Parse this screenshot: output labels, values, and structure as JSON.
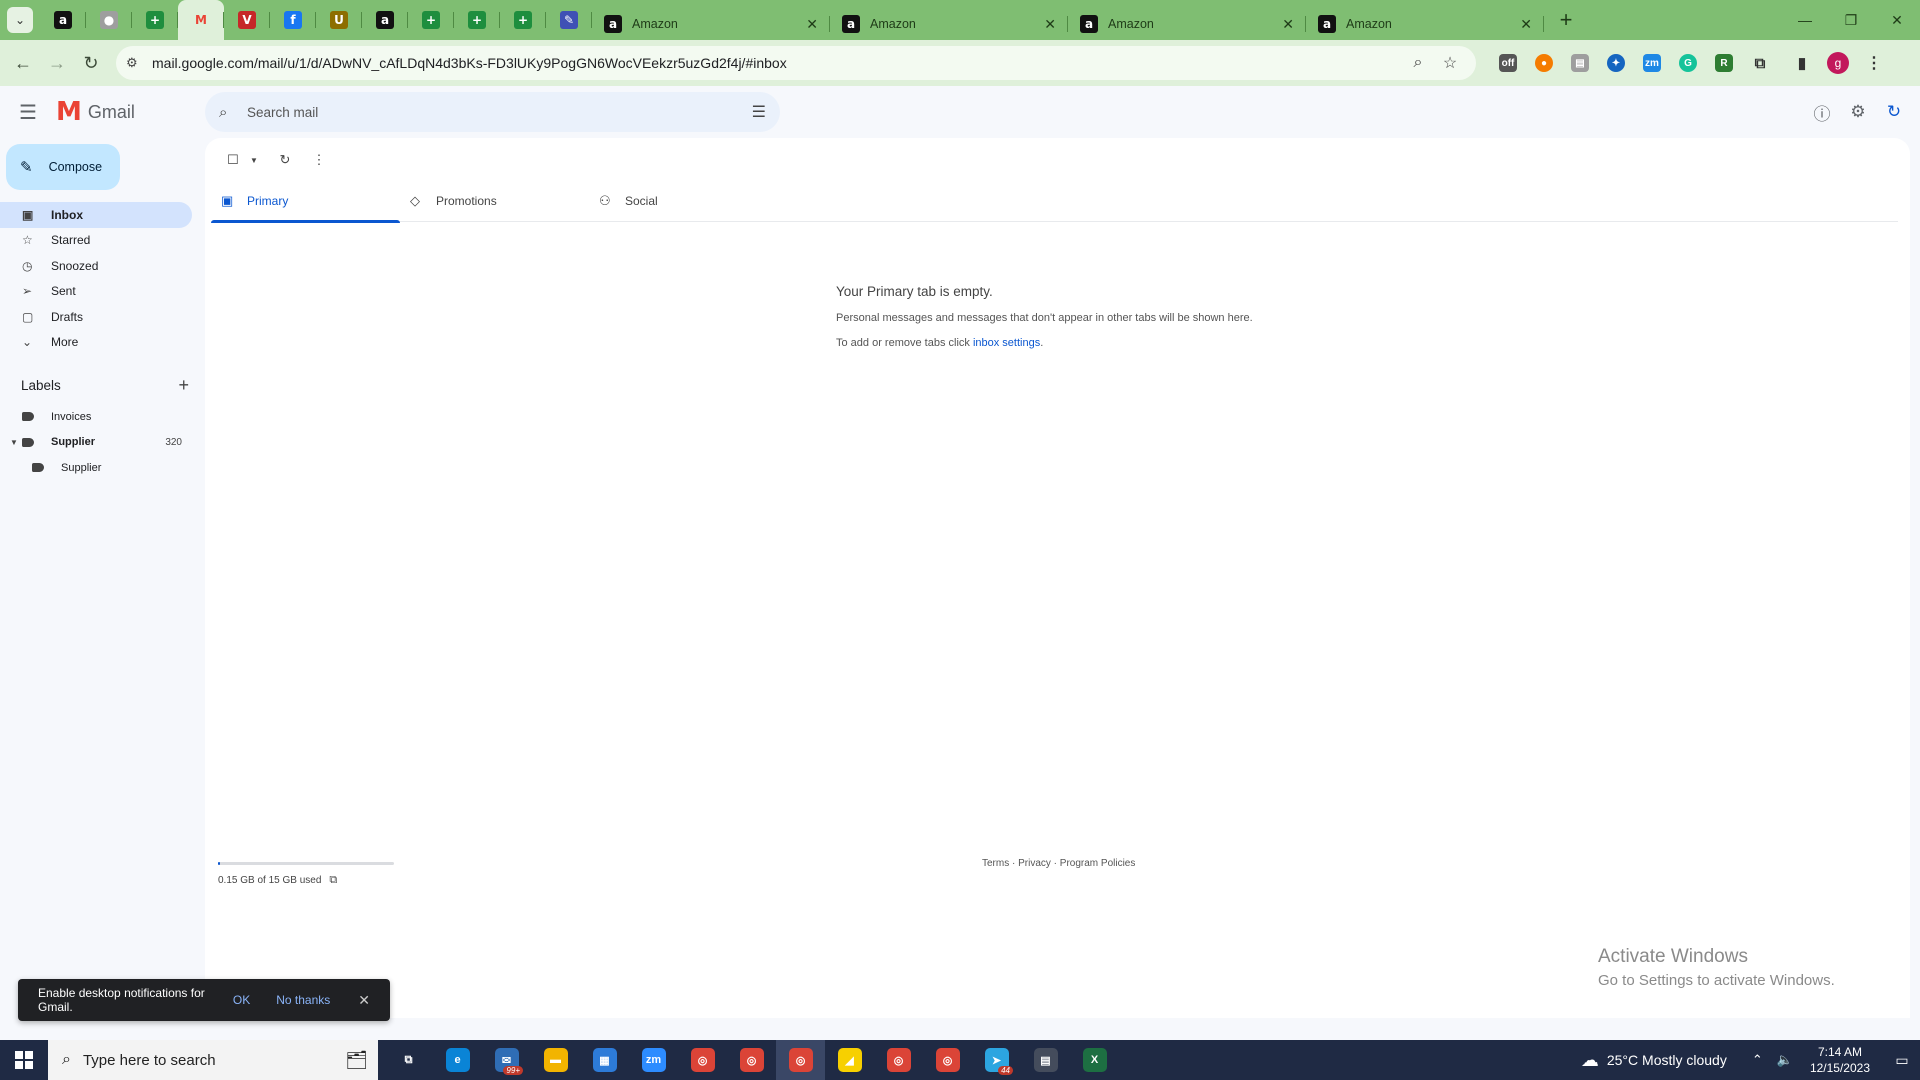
{
  "browser": {
    "tab_menu_icon": "chevron-down-icon",
    "pinned_tabs": [
      {
        "icon": "amazon-icon",
        "glyph": "a",
        "color": "#111111"
      },
      {
        "icon": "gray-circle-icon",
        "glyph": "●",
        "color": "#9e9e9e"
      },
      {
        "icon": "green-sheets-icon",
        "glyph": "+",
        "color": "#1e8e3e"
      },
      {
        "icon": "gmail-icon",
        "glyph": "M",
        "color": "#ea4335"
      },
      {
        "icon": "red-v-icon",
        "glyph": "V",
        "color": "#c62828"
      },
      {
        "icon": "facebook-icon",
        "glyph": "f",
        "color": "#1877f2"
      },
      {
        "icon": "us-flag-icon",
        "glyph": "U",
        "color": "#8d6e00"
      },
      {
        "icon": "amazon-icon",
        "glyph": "a",
        "color": "#111111"
      },
      {
        "icon": "green-sheets-icon",
        "glyph": "+",
        "color": "#1e8e3e"
      },
      {
        "icon": "green-sheets-icon",
        "glyph": "+",
        "color": "#1e8e3e"
      },
      {
        "icon": "green-sheets-icon",
        "glyph": "+",
        "color": "#1e8e3e"
      },
      {
        "icon": "feather-icon",
        "glyph": "✎",
        "color": "#3f51b5"
      }
    ],
    "tabs": [
      {
        "label": "Amazon"
      },
      {
        "label": "Amazon"
      },
      {
        "label": "Amazon"
      },
      {
        "label": "Amazon"
      }
    ],
    "url": "mail.google.com/mail/u/1/d/ADwNV_cAfLDqN4d3bKs-FD3lUKy9PogGN6WocVEekzr5uzGd2f4j/#inbox",
    "profile_initial": "g"
  },
  "gmail": {
    "app_name": "Gmail",
    "search_placeholder": "Search mail",
    "compose_label": "Compose",
    "nav": [
      {
        "label": "Inbox",
        "icon": "inbox-icon",
        "glyph": "▣",
        "active": true
      },
      {
        "label": "Starred",
        "icon": "star-icon",
        "glyph": "☆",
        "active": false
      },
      {
        "label": "Snoozed",
        "icon": "clock-icon",
        "glyph": "◷",
        "active": false
      },
      {
        "label": "Sent",
        "icon": "send-icon",
        "glyph": "➢",
        "active": false
      },
      {
        "label": "Drafts",
        "icon": "draft-icon",
        "glyph": "▢",
        "active": false
      },
      {
        "label": "More",
        "icon": "chevron-down-icon",
        "glyph": "⌄",
        "active": false
      }
    ],
    "labels_title": "Labels",
    "labels": [
      {
        "name": "Invoices",
        "count": "",
        "expanded": false,
        "bold": false
      },
      {
        "name": "Supplier",
        "count": "320",
        "expanded": true,
        "bold": true
      },
      {
        "name": "Supplier",
        "count": "",
        "expanded": false,
        "bold": false,
        "child": true
      }
    ],
    "category_tabs": [
      {
        "label": "Primary",
        "icon": "inbox-icon",
        "glyph": "▣",
        "active": true
      },
      {
        "label": "Promotions",
        "icon": "tag-icon",
        "glyph": "◇",
        "active": false
      },
      {
        "label": "Social",
        "icon": "people-icon",
        "glyph": "⚇",
        "active": false
      }
    ],
    "empty_state": {
      "title": "Your Primary tab is empty.",
      "line1": "Personal messages and messages that don't appear in other tabs will be shown here.",
      "line2_prefix": "To add or remove tabs click ",
      "line2_link": "inbox settings",
      "line2_suffix": "."
    },
    "storage": {
      "text": "0.15 GB of 15 GB used",
      "fraction_used": 0.01
    },
    "footer": "Terms · Privacy · Program Policies",
    "snackbar": {
      "text": "Enable desktop notifications for Gmail.",
      "ok": "OK",
      "no": "No thanks"
    }
  },
  "windows": {
    "watermark_line1": "Activate Windows",
    "watermark_line2": "Go to Settings to activate Windows.",
    "search_placeholder": "Type here to search",
    "weather": "25°C  Mostly cloudy",
    "time": "7:14 AM",
    "date": "12/15/2023",
    "taskbar_apps": [
      {
        "icon": "task-view-icon",
        "glyph": "⧉",
        "color": "#1f2a44",
        "active": false,
        "badge": ""
      },
      {
        "icon": "edge-icon",
        "glyph": "e",
        "color": "#0a84d6",
        "active": false,
        "badge": ""
      },
      {
        "icon": "mail-icon",
        "glyph": "✉",
        "color": "#2f6db5",
        "active": false,
        "badge": "99+"
      },
      {
        "icon": "file-explorer-icon",
        "glyph": "▬",
        "color": "#f2b400",
        "active": false,
        "badge": ""
      },
      {
        "icon": "store-icon",
        "glyph": "▦",
        "color": "#2d7bd8",
        "active": false,
        "badge": ""
      },
      {
        "icon": "zoom-icon",
        "glyph": "zm",
        "color": "#2d8cff",
        "active": false,
        "badge": ""
      },
      {
        "icon": "chrome-icon",
        "glyph": "◎",
        "color": "#db4437",
        "active": false,
        "badge": ""
      },
      {
        "icon": "chrome-icon",
        "glyph": "◎",
        "color": "#db4437",
        "active": false,
        "badge": ""
      },
      {
        "icon": "chrome-icon",
        "glyph": "◎",
        "color": "#db4437",
        "active": true,
        "badge": ""
      },
      {
        "icon": "sticky-notes-icon",
        "glyph": "◢",
        "color": "#f7d000",
        "active": false,
        "badge": ""
      },
      {
        "icon": "chrome-icon",
        "glyph": "◎",
        "color": "#db4437",
        "active": false,
        "badge": ""
      },
      {
        "icon": "chrome-icon",
        "glyph": "◎",
        "color": "#db4437",
        "active": false,
        "badge": ""
      },
      {
        "icon": "telegram-icon",
        "glyph": "➤",
        "color": "#2ca5e0",
        "active": false,
        "badge": "44"
      },
      {
        "icon": "calculator-icon",
        "glyph": "▤",
        "color": "#444c5c",
        "active": false,
        "badge": ""
      },
      {
        "icon": "excel-icon",
        "glyph": "X",
        "color": "#1d6f42",
        "active": false,
        "badge": ""
      }
    ]
  }
}
